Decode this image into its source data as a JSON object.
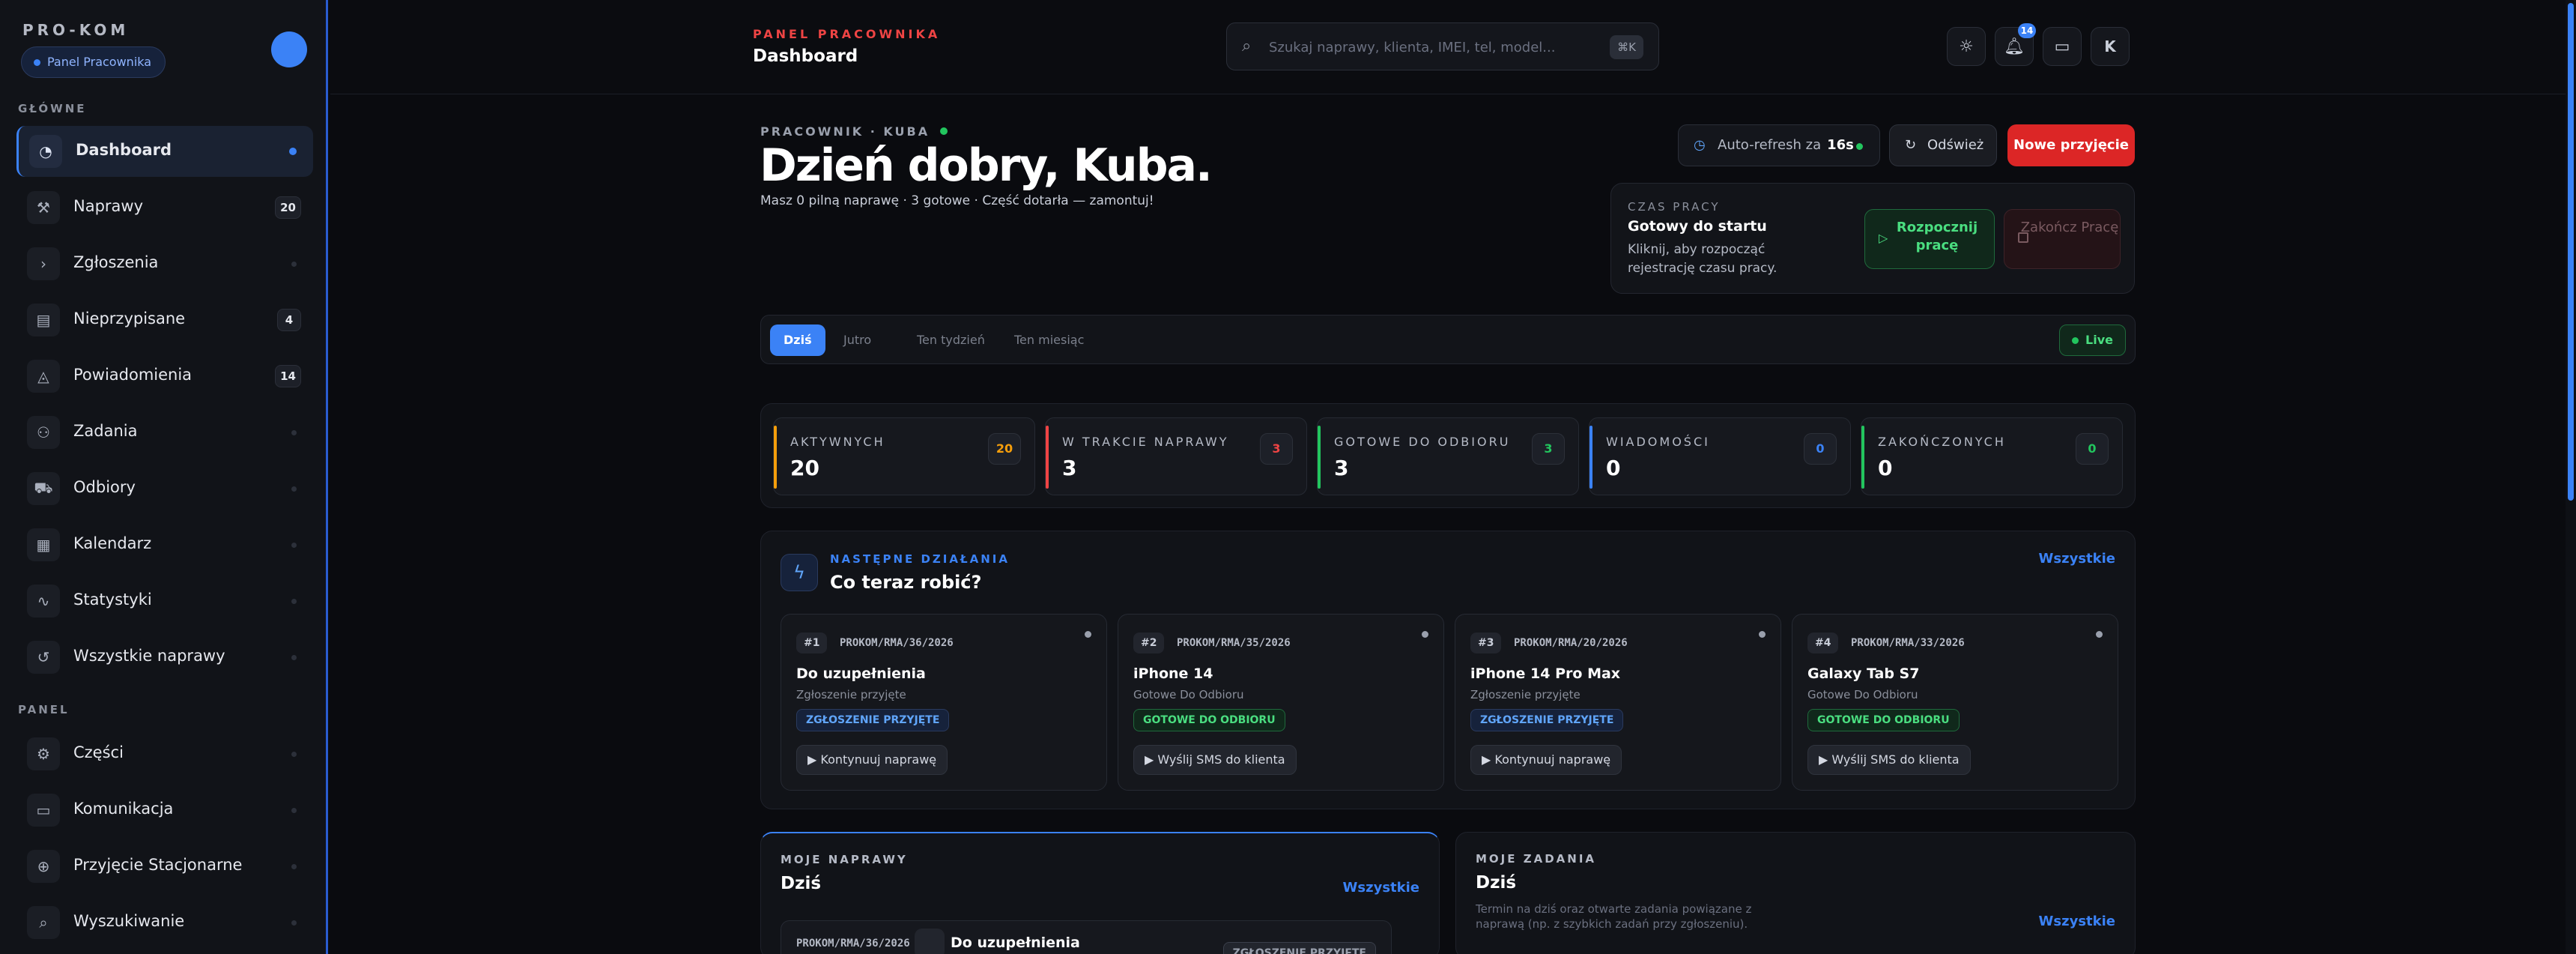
{
  "sidebar": {
    "brand": "PRO-KOM",
    "pill": "Panel Pracownika",
    "section_main": "GŁÓWNE",
    "section_panel": "PANEL",
    "items": [
      {
        "label": "Dashboard",
        "icon": "dashboard-icon",
        "badge": null,
        "active": true
      },
      {
        "label": "Naprawy",
        "icon": "wrench-icon",
        "badge": "20"
      },
      {
        "label": "Zgłoszenia",
        "icon": "chevron-right-icon",
        "badge": null
      },
      {
        "label": "Nieprzypisane",
        "icon": "clipboard-icon",
        "badge": "4"
      },
      {
        "label": "Powiadomienia",
        "icon": "bell-icon",
        "badge": "14"
      },
      {
        "label": "Zadania",
        "icon": "users-icon",
        "badge": null
      },
      {
        "label": "Odbiory",
        "icon": "truck-icon",
        "badge": null
      },
      {
        "label": "Kalendarz",
        "icon": "calendar-icon",
        "badge": null
      },
      {
        "label": "Statystyki",
        "icon": "activity-icon",
        "badge": null
      },
      {
        "label": "Wszystkie naprawy",
        "icon": "history-icon",
        "badge": null
      }
    ],
    "panel_items": [
      {
        "label": "Części",
        "icon": "parts-icon"
      },
      {
        "label": "Komunikacja",
        "icon": "chat-icon"
      },
      {
        "label": "Przyjęcie Stacjonarne",
        "icon": "plus-circle-icon"
      },
      {
        "label": "Wyszukiwanie",
        "icon": "search-icon"
      }
    ]
  },
  "header": {
    "kicker": "PANEL PRACOWNIKA",
    "title": "Dashboard",
    "search_placeholder": "Szukaj naprawy, klienta, IMEI, tel, model...",
    "search_shortcut": "⌘K",
    "notif_badge": "14",
    "user_initial": "K"
  },
  "greeting": {
    "kicker": "PRACOWNIK · KUBA",
    "title": "Dzień dobry, Kuba.",
    "subtitle": "Masz 0 pilną naprawę · 3 gotowe · Część dotarła — zamontuj!"
  },
  "toolbar": {
    "autorefresh_label": "Auto-refresh za",
    "autorefresh_value": "16s",
    "refresh": "Odśwież",
    "new": "Nowe przyjęcie"
  },
  "worktime": {
    "kicker": "CZAS PRACY",
    "title": "Gotowy do startu",
    "desc": "Kliknij, aby rozpocząć rejestrację czasu pracy.",
    "start": "Rozpocznij pracę",
    "stop": "Zakończ Pracę"
  },
  "tabs": {
    "items": [
      "Dziś",
      "Jutro",
      "Ten tydzień",
      "Ten miesiąc"
    ],
    "active": 0,
    "live": "Live"
  },
  "stats": [
    {
      "label": "AKTYWNYCH",
      "value": "20",
      "pill": "20",
      "color": "#f59e0b"
    },
    {
      "label": "W TRAKCIE NAPRAWY",
      "value": "3",
      "pill": "3",
      "color": "#ef4444"
    },
    {
      "label": "GOTOWE DO ODBIORU",
      "value": "3",
      "pill": "3",
      "color": "#22c55e"
    },
    {
      "label": "WIADOMOŚCI",
      "value": "0",
      "pill": "0",
      "color": "#3b82f6"
    },
    {
      "label": "ZAKOŃCZONYCH",
      "value": "0",
      "pill": "0",
      "color": "#22c55e"
    }
  ],
  "next": {
    "kicker": "NASTĘPNE DZIAŁANIA",
    "title": "Co teraz robić?",
    "all": "Wszystkie",
    "actions": [
      {
        "num": "#1",
        "ref": "PROKOM/RMA/36/2026",
        "title": "Do uzupełnienia",
        "sub": "Zgłoszenie przyjęte",
        "status": "ZGŁOSZENIE PRZYJĘTE",
        "status_color": "blue",
        "button": "▶ Kontynuuj naprawę"
      },
      {
        "num": "#2",
        "ref": "PROKOM/RMA/35/2026",
        "title": "iPhone 14",
        "sub": "Gotowe Do Odbioru",
        "status": "GOTOWE DO ODBIORU",
        "status_color": "green",
        "button": "▶ Wyślij SMS do klienta"
      },
      {
        "num": "#3",
        "ref": "PROKOM/RMA/20/2026",
        "title": "iPhone 14 Pro Max",
        "sub": "Zgłoszenie przyjęte",
        "status": "ZGŁOSZENIE PRZYJĘTE",
        "status_color": "blue",
        "button": "▶ Kontynuuj naprawę"
      },
      {
        "num": "#4",
        "ref": "PROKOM/RMA/33/2026",
        "title": "Galaxy Tab S7",
        "sub": "Gotowe Do Odbioru",
        "status": "GOTOWE DO ODBIORU",
        "status_color": "green",
        "button": "▶ Wyślij SMS do klienta"
      }
    ]
  },
  "my_repairs": {
    "kicker": "MOJE NAPRAWY",
    "title": "Dziś",
    "all": "Wszystkie",
    "row": {
      "ref": "PROKOM/RMA/36/2026",
      "title": "Do uzupełnienia",
      "status": "ZGŁOSZENIE PRZYJĘTE"
    }
  },
  "my_tasks": {
    "kicker": "MOJE ZADANIA",
    "title": "Dziś",
    "desc": "Termin na dziś oraz otwarte zadania powiązane z naprawą (np. z szybkich zadań przy zgłoszeniu).",
    "all": "Wszystkie"
  }
}
